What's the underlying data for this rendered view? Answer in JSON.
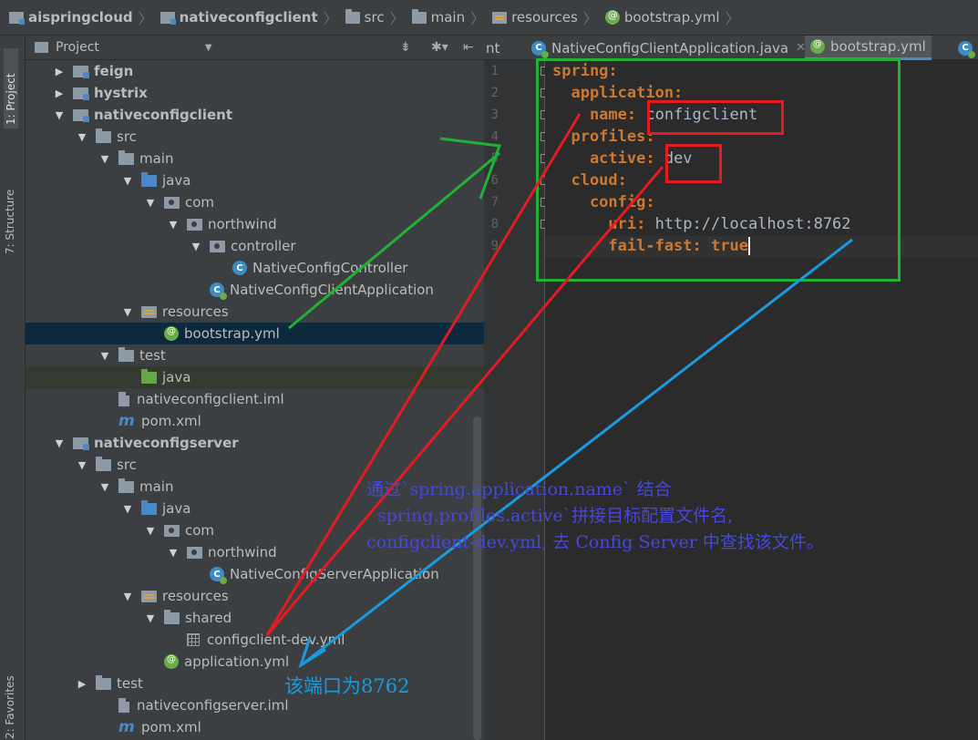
{
  "breadcrumb": {
    "items": [
      {
        "label": "aispringcloud",
        "icon": "module-folder-icon"
      },
      {
        "label": "nativeconfigclient",
        "icon": "module-folder-icon"
      },
      {
        "label": "src",
        "icon": "folder-icon"
      },
      {
        "label": "main",
        "icon": "folder-icon"
      },
      {
        "label": "resources",
        "icon": "resources-folder-icon"
      },
      {
        "label": "bootstrap.yml",
        "icon": "spring-yml-icon"
      }
    ]
  },
  "tool_strip": {
    "project_tab": "1: Project",
    "structure_tab": "7: Structure",
    "favorites_tab": "2: Favorites"
  },
  "project_panel": {
    "title": "Project",
    "tree": [
      {
        "label": "feign",
        "expanded": false,
        "icon": "module-folder-icon",
        "bold": true
      },
      {
        "label": "hystrix",
        "expanded": false,
        "icon": "module-folder-icon",
        "bold": true
      },
      {
        "label": "nativeconfigclient",
        "expanded": true,
        "icon": "module-folder-icon",
        "bold": true
      },
      {
        "label": "src",
        "expanded": true,
        "icon": "folder-icon"
      },
      {
        "label": "main",
        "expanded": true,
        "icon": "folder-icon"
      },
      {
        "label": "java",
        "expanded": true,
        "icon": "source-folder-icon"
      },
      {
        "label": "com",
        "expanded": true,
        "icon": "package-icon"
      },
      {
        "label": "northwind",
        "expanded": true,
        "icon": "package-icon"
      },
      {
        "label": "controller",
        "expanded": true,
        "icon": "package-icon"
      },
      {
        "label": "NativeConfigController",
        "icon": "java-class-icon"
      },
      {
        "label": "NativeConfigClientApplication",
        "icon": "spring-boot-class-icon"
      },
      {
        "label": "resources",
        "expanded": true,
        "icon": "resources-folder-icon"
      },
      {
        "label": "bootstrap.yml",
        "icon": "spring-yml-icon",
        "selected": true
      },
      {
        "label": "test",
        "expanded": true,
        "icon": "folder-icon"
      },
      {
        "label": "java",
        "icon": "test-source-folder-icon"
      },
      {
        "label": "nativeconfigclient.iml",
        "icon": "iml-file-icon"
      },
      {
        "label": "pom.xml",
        "icon": "maven-icon"
      },
      {
        "label": "nativeconfigserver",
        "expanded": true,
        "icon": "module-folder-icon",
        "bold": true
      },
      {
        "label": "src",
        "expanded": true,
        "icon": "folder-icon"
      },
      {
        "label": "main",
        "expanded": true,
        "icon": "folder-icon"
      },
      {
        "label": "java",
        "expanded": true,
        "icon": "source-folder-icon"
      },
      {
        "label": "com",
        "expanded": true,
        "icon": "package-icon"
      },
      {
        "label": "northwind",
        "expanded": true,
        "icon": "package-icon"
      },
      {
        "label": "NativeConfigServerApplication",
        "icon": "spring-boot-class-icon"
      },
      {
        "label": "resources",
        "expanded": true,
        "icon": "resources-folder-icon"
      },
      {
        "label": "shared",
        "expanded": true,
        "icon": "folder-icon"
      },
      {
        "label": "configclient-dev.yml",
        "icon": "yml-grid-icon"
      },
      {
        "label": "application.yml",
        "icon": "spring-yml-icon"
      },
      {
        "label": "test",
        "expanded": false,
        "icon": "folder-icon"
      },
      {
        "label": "nativeconfigserver.iml",
        "icon": "iml-file-icon"
      },
      {
        "label": "pom.xml",
        "icon": "maven-icon"
      }
    ]
  },
  "editor": {
    "tabs": [
      {
        "label": "nt",
        "partial": true
      },
      {
        "label": "NativeConfigClientApplication.java",
        "icon": "spring-boot-class-icon"
      },
      {
        "label": "bootstrap.yml",
        "icon": "spring-yml-icon",
        "active": true
      }
    ],
    "line_numbers": [
      "1",
      "2",
      "3",
      "4",
      "5",
      "6",
      "7",
      "8",
      "9"
    ],
    "code_lines": [
      [
        {
          "t": "spring:",
          "c": "k"
        }
      ],
      [
        {
          "t": "  application:",
          "c": "k"
        }
      ],
      [
        {
          "t": "    name: ",
          "c": "k"
        },
        {
          "t": "configclient",
          "c": "v"
        }
      ],
      [
        {
          "t": "  profiles:",
          "c": "k"
        }
      ],
      [
        {
          "t": "    active: ",
          "c": "k"
        },
        {
          "t": "dev",
          "c": "v"
        }
      ],
      [
        {
          "t": "  cloud:",
          "c": "k"
        }
      ],
      [
        {
          "t": "    config:",
          "c": "k"
        }
      ],
      [
        {
          "t": "      uri: ",
          "c": "k"
        },
        {
          "t": "http://localhost:8762",
          "c": "v"
        }
      ],
      [
        {
          "t": "      fail-fast: ",
          "c": "k"
        },
        {
          "t": "true",
          "c": "k"
        }
      ]
    ]
  },
  "annotations": {
    "line1": "通过`spring.application.name` 结合",
    "line2": "spring.profiles.active`拼接目标配置文件名,",
    "line3": "configclient-dev.yml, 去 Config Server 中查找该文件。",
    "port_note": "该端口为8762"
  },
  "colors": {
    "green_box": "#21b135",
    "red_box": "#e31b23",
    "blue_arrow": "#1a9be0",
    "annotation_text": "#4848d8"
  }
}
